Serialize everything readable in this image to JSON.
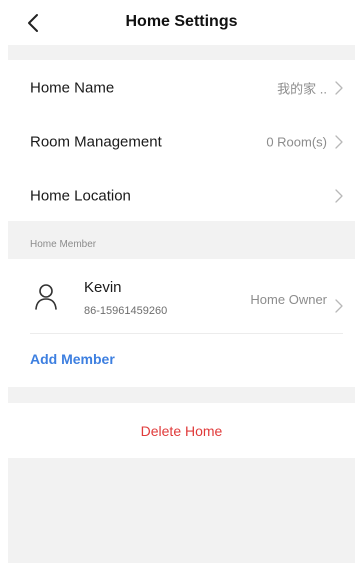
{
  "header": {
    "title": "Home Settings",
    "back_icon": "chevron-left-icon"
  },
  "settings": [
    {
      "label": "Home Name",
      "value": "我的家 .."
    },
    {
      "label": "Room Management",
      "value": "0 Room(s)"
    },
    {
      "label": "Home Location",
      "value": ""
    }
  ],
  "members_section": {
    "label": "Home Member",
    "members": [
      {
        "name": "Kevin",
        "phone": "86-15961459260",
        "role": "Home Owner",
        "avatar_icon": "user-icon"
      }
    ],
    "add_label": "Add Member"
  },
  "delete_label": "Delete Home",
  "colors": {
    "background": "#f2f2f2",
    "card": "#ffffff",
    "accent_blue": "#3d7fe0",
    "danger_red": "#e03b3b",
    "secondary_text": "#8c8c8c"
  }
}
